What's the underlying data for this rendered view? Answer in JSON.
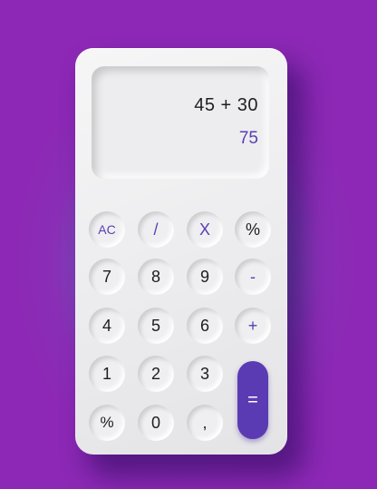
{
  "display": {
    "expression": "45 + 30",
    "result": "75"
  },
  "keys": {
    "ac": "AC",
    "divide": "/",
    "multiply": "X",
    "percent_top": "%",
    "seven": "7",
    "eight": "8",
    "nine": "9",
    "minus": "-",
    "four": "4",
    "five": "5",
    "six": "6",
    "plus": "+",
    "one": "1",
    "two": "2",
    "three": "3",
    "equals": "=",
    "percent_bottom": "%",
    "zero": "0",
    "comma": ","
  },
  "colors": {
    "accent": "#5b3bb3",
    "background": "#8c28b5"
  }
}
